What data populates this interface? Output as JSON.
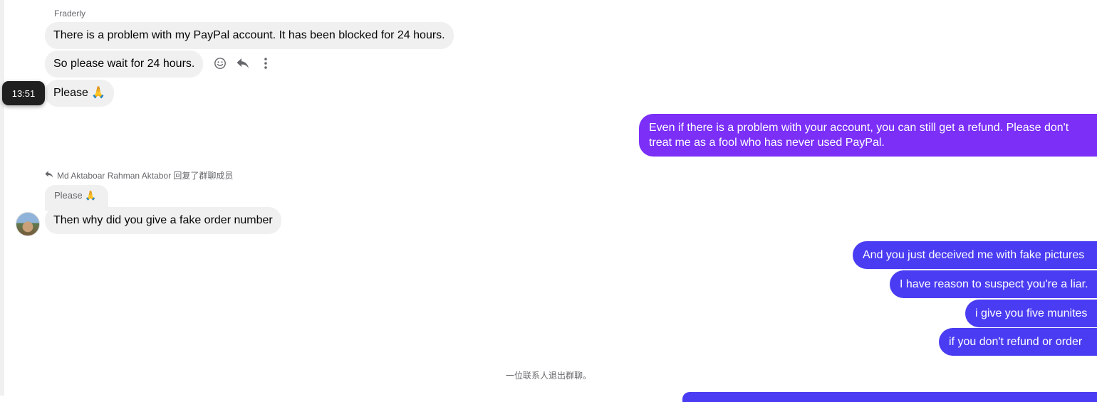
{
  "colors": {
    "incoming_bubble": "#f0f0f0",
    "outgoing_purple": "#7b2ff7",
    "outgoing_blue": "#4a3cf2",
    "muted_text": "#65676b"
  },
  "group1": {
    "sender": "Fraderly",
    "messages": [
      "There is a problem with my PayPal account. It has been blocked for 24 hours.",
      "So please wait for 24 hours.",
      "Please 🙏"
    ],
    "time_tooltip": "13:51",
    "action_icons": [
      "smile-icon",
      "reply-icon",
      "more-vertical-icon"
    ]
  },
  "outgoing1": {
    "line1": "Even if there is a problem with your account, you can still get a refund. Please don't",
    "line2": "treat me as a fool who has never used PayPal."
  },
  "reply": {
    "header": "Md Aktaboar Rahman Aktabor 回复了群聊成员",
    "quoted": "Please 🙏",
    "message": "Then why did you give a fake order number"
  },
  "outgoing2": [
    "And you just deceived me with fake pictures",
    "I have reason to suspect you're a liar.",
    "i give you five munites",
    "if you don't refund or order"
  ],
  "system_notice": "一位联系人退出群聊。"
}
